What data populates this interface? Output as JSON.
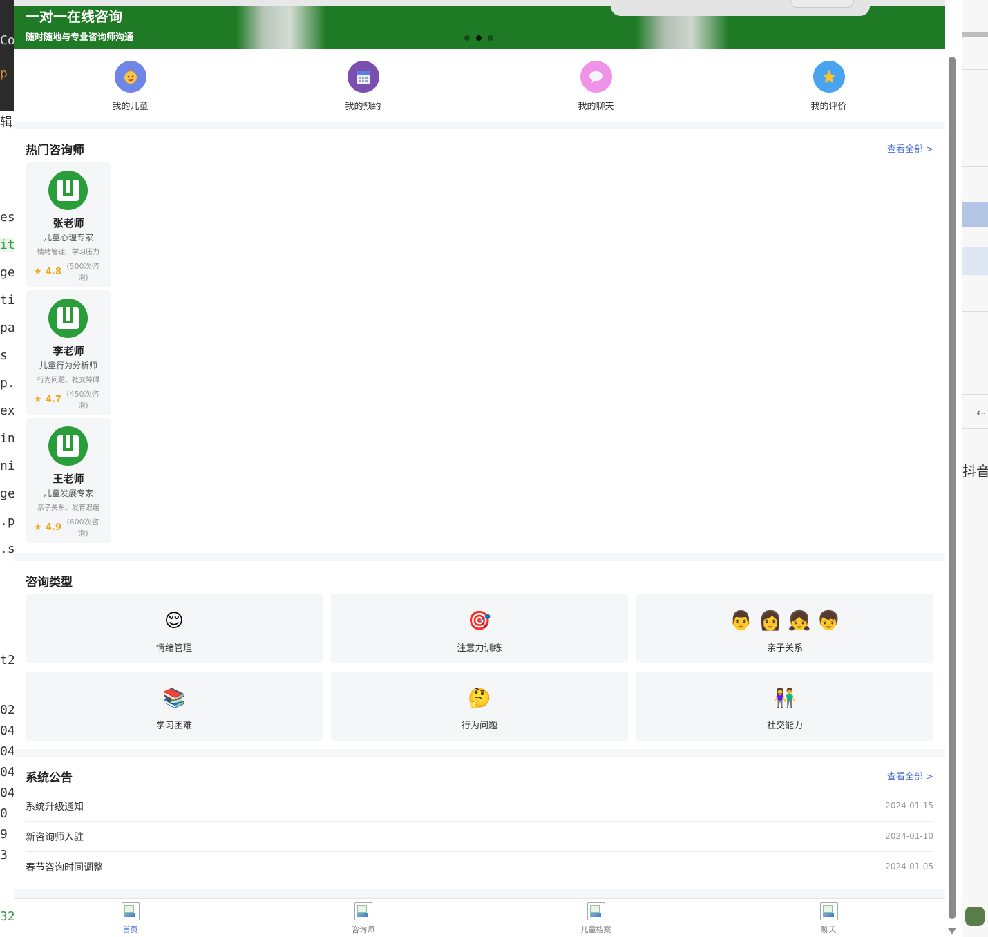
{
  "banner": {
    "title": "一对一在线咨询",
    "subtitle": "随时随地与专业咨询师沟通",
    "slide_count": 3,
    "active_slide": 2
  },
  "quick_actions": [
    {
      "label": "我的儿童",
      "icon": "baby-face-icon",
      "color": "#6f86e6"
    },
    {
      "label": "我的预约",
      "icon": "calendar-icon",
      "color": "#7a4fb0"
    },
    {
      "label": "我的聊天",
      "icon": "speech-bubble-icon",
      "color": "#ee93e8"
    },
    {
      "label": "我的评价",
      "icon": "star-icon",
      "color": "#4aa3ee"
    }
  ],
  "hot_counselors": {
    "title": "热门咨询师",
    "view_all": "查看全部 >",
    "items": [
      {
        "name": "张老师",
        "title": "儿童心理专家",
        "tags": "情绪管理、学习压力",
        "rating": "4.8",
        "count": "(500次咨询)"
      },
      {
        "name": "李老师",
        "title": "儿童行为分析师",
        "tags": "行为问题、社交障碍",
        "rating": "4.7",
        "count": "(450次咨询)"
      },
      {
        "name": "王老师",
        "title": "儿童发展专家",
        "tags": "亲子关系、发育迟缓",
        "rating": "4.9",
        "count": "(600次咨询)"
      }
    ]
  },
  "consult_types": {
    "title": "咨询类型",
    "items": [
      {
        "label": "情绪管理",
        "emoji": "😌",
        "icon": "relieved-face-icon"
      },
      {
        "label": "注意力训练",
        "emoji": "🎯",
        "icon": "target-icon"
      },
      {
        "label": "亲子关系",
        "emoji": "👨 👩 👧 👦",
        "icon": "family-icon"
      },
      {
        "label": "学习困难",
        "emoji": "📚",
        "icon": "books-icon"
      },
      {
        "label": "行为问题",
        "emoji": "🤔",
        "icon": "thinking-face-icon"
      },
      {
        "label": "社交能力",
        "emoji": "👫",
        "icon": "people-holding-hands-icon"
      }
    ]
  },
  "notices": {
    "title": "系统公告",
    "view_all": "查看全部 >",
    "items": [
      {
        "title": "系统升级通知",
        "date": "2024-01-15"
      },
      {
        "title": "新咨询师入驻",
        "date": "2024-01-10"
      },
      {
        "title": "春节咨询时间调整",
        "date": "2024-01-05"
      }
    ]
  },
  "tabbar": {
    "items": [
      {
        "label": "首页",
        "active": true
      },
      {
        "label": "咨询师",
        "active": false
      },
      {
        "label": "儿童档案",
        "active": false
      },
      {
        "label": "聊天",
        "active": false
      }
    ]
  },
  "background_fragments": {
    "left": [
      "Co",
      "p",
      "辑",
      "es",
      "ite",
      "ge",
      "tic",
      "pa",
      "s",
      "p.v",
      "ex",
      "in",
      "ni",
      "ge",
      ".p",
      ".sc",
      "t2",
      "02",
      "04",
      "04",
      "04",
      "04",
      "0",
      "9",
      "3",
      "32"
    ],
    "right": [
      "抖音"
    ]
  },
  "colors": {
    "brand_green": "#1e7a25",
    "avatar_green": "#2a9d3b",
    "link_blue": "#4a6fd1",
    "rating_gold": "#f0a81c"
  }
}
